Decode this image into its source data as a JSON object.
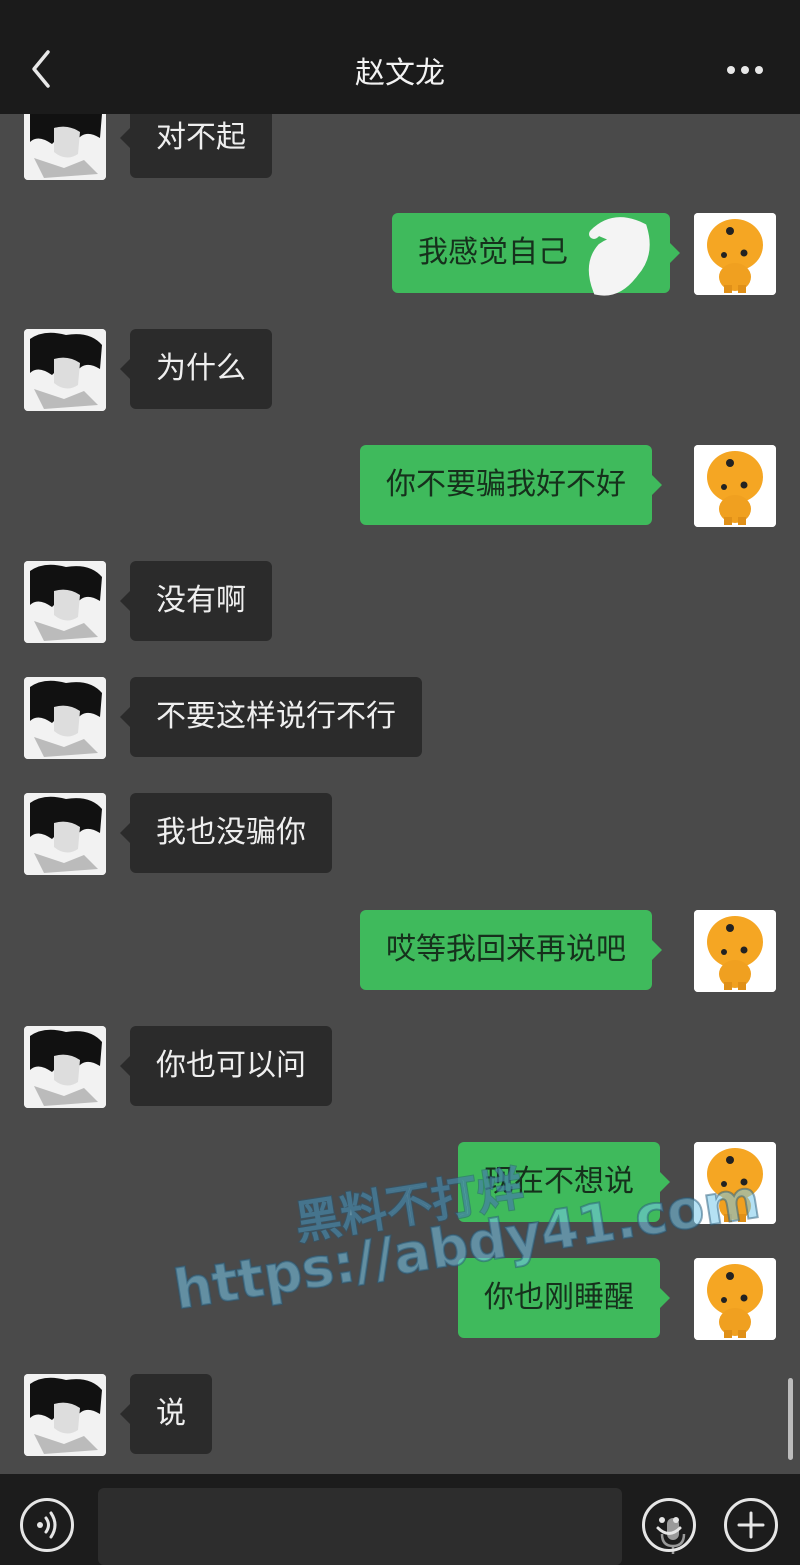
{
  "header": {
    "title": "赵文龙",
    "back_icon": "chevron-left-icon",
    "more_icon": "ellipsis-icon"
  },
  "messages": [
    {
      "side": "left",
      "text": "对不起"
    },
    {
      "side": "right",
      "text": "我感觉自己"
    },
    {
      "side": "left",
      "text": "为什么"
    },
    {
      "side": "right",
      "text": "你不要骗我好不好"
    },
    {
      "side": "left",
      "text": "没有啊"
    },
    {
      "side": "left",
      "text": "不要这样说行不行"
    },
    {
      "side": "left",
      "text": "我也没骗你"
    },
    {
      "side": "right",
      "text": "哎等我回来再说吧"
    },
    {
      "side": "left",
      "text": "你也可以问"
    },
    {
      "side": "right",
      "text": "现在不想说"
    },
    {
      "side": "right",
      "text": "你也刚睡醒"
    },
    {
      "side": "left",
      "text": "说"
    }
  ],
  "watermark": {
    "line1": "黑料不打烊",
    "line2": "https://abdy41.com"
  },
  "footer": {
    "voice_icon": "voice-mode-icon",
    "mic_icon": "microphone-icon",
    "emoji_icon": "emoji-icon",
    "plus_icon": "plus-icon"
  },
  "colors": {
    "chat_bg": "#4a4a4a",
    "header_bg": "#1b1b1b",
    "sent_bubble": "#3fba5c",
    "received_bubble": "#2b2b2b"
  }
}
